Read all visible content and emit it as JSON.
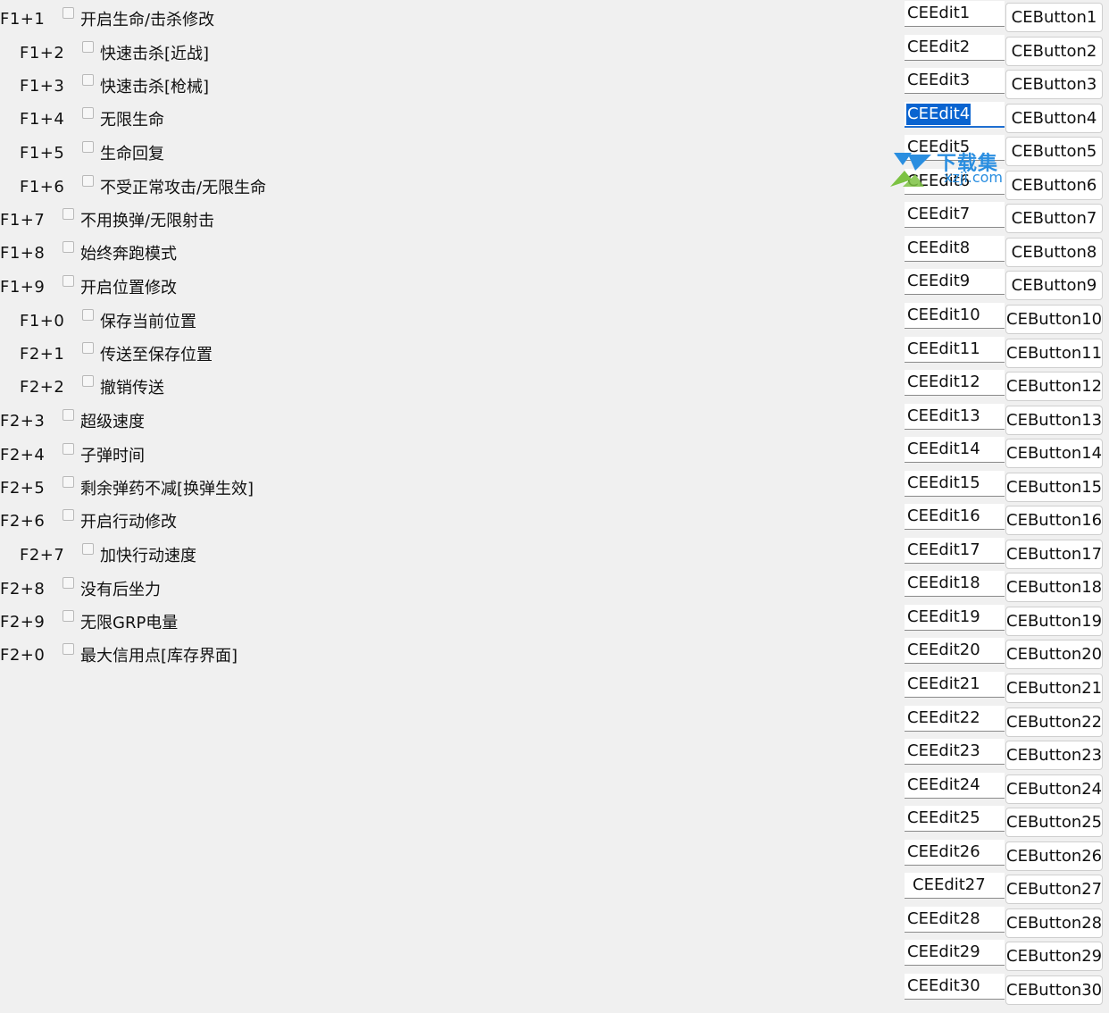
{
  "options": [
    {
      "hotkey": "F1+1",
      "label": "开启生命/击杀修改",
      "indent": false
    },
    {
      "hotkey": "F1+2",
      "label": "快速击杀[近战]",
      "indent": true
    },
    {
      "hotkey": "F1+3",
      "label": "快速击杀[枪械]",
      "indent": true
    },
    {
      "hotkey": "F1+4",
      "label": "无限生命",
      "indent": true
    },
    {
      "hotkey": "F1+5",
      "label": "生命回复",
      "indent": true
    },
    {
      "hotkey": "F1+6",
      "label": "不受正常攻击/无限生命",
      "indent": true
    },
    {
      "hotkey": "F1+7",
      "label": "不用换弹/无限射击",
      "indent": false
    },
    {
      "hotkey": "F1+8",
      "label": "始终奔跑模式",
      "indent": false
    },
    {
      "hotkey": "F1+9",
      "label": "开启位置修改",
      "indent": false
    },
    {
      "hotkey": "F1+0",
      "label": "保存当前位置",
      "indent": true
    },
    {
      "hotkey": "F2+1",
      "label": "传送至保存位置",
      "indent": true
    },
    {
      "hotkey": "F2+2",
      "label": "撤销传送",
      "indent": true
    },
    {
      "hotkey": "F2+3",
      "label": "超级速度",
      "indent": false
    },
    {
      "hotkey": "F2+4",
      "label": "子弹时间",
      "indent": false
    },
    {
      "hotkey": "F2+5",
      "label": "剩余弹药不减[换弹生效]",
      "indent": false
    },
    {
      "hotkey": "F2+6",
      "label": "开启行动修改",
      "indent": false
    },
    {
      "hotkey": "F2+7",
      "label": "加快行动速度",
      "indent": true
    },
    {
      "hotkey": "F2+8",
      "label": "没有后坐力",
      "indent": false
    },
    {
      "hotkey": "F2+9",
      "label": "无限GRP电量",
      "indent": false
    },
    {
      "hotkey": "F2+0",
      "label": "最大信用点[库存界面]",
      "indent": false
    }
  ],
  "controls": [
    {
      "edit": "CEEdit1",
      "button": "CEButton1"
    },
    {
      "edit": "CEEdit2",
      "button": "CEButton2"
    },
    {
      "edit": "CEEdit3",
      "button": "CEButton3"
    },
    {
      "edit": "CEEdit4",
      "button": "CEButton4",
      "selected": true
    },
    {
      "edit": "CEEdit5",
      "button": "CEButton5"
    },
    {
      "edit": "CEEdit6",
      "button": "CEButton6"
    },
    {
      "edit": "CEEdit7",
      "button": "CEButton7"
    },
    {
      "edit": "CEEdit8",
      "button": "CEButton8"
    },
    {
      "edit": "CEEdit9",
      "button": "CEButton9"
    },
    {
      "edit": "CEEdit10",
      "button": "CEButton10"
    },
    {
      "edit": "CEEdit11",
      "button": "CEButton11"
    },
    {
      "edit": "CEEdit12",
      "button": "CEButton12"
    },
    {
      "edit": "CEEdit13",
      "button": "CEButton13"
    },
    {
      "edit": "CEEdit14",
      "button": "CEButton14"
    },
    {
      "edit": "CEEdit15",
      "button": "CEButton15"
    },
    {
      "edit": "CEEdit16",
      "button": "CEButton16"
    },
    {
      "edit": "CEEdit17",
      "button": "CEButton17"
    },
    {
      "edit": "CEEdit18",
      "button": "CEButton18"
    },
    {
      "edit": "CEEdit19",
      "button": "CEButton19"
    },
    {
      "edit": "CEEdit20",
      "button": "CEButton20"
    },
    {
      "edit": "CEEdit21",
      "button": "CEButton21"
    },
    {
      "edit": "CEEdit22",
      "button": "CEButton22"
    },
    {
      "edit": "CEEdit23",
      "button": "CEButton23"
    },
    {
      "edit": "CEEdit24",
      "button": "CEButton24"
    },
    {
      "edit": "CEEdit25",
      "button": "CEButton25"
    },
    {
      "edit": "CEEdit26",
      "button": "CEButton26"
    },
    {
      "edit": "CEEdit27",
      "button": "CEButton27",
      "shifted": true
    },
    {
      "edit": "CEEdit28",
      "button": "CEButton28"
    },
    {
      "edit": "CEEdit29",
      "button": "CEButton29"
    },
    {
      "edit": "CEEdit30",
      "button": "CEButton30"
    }
  ],
  "watermark": {
    "text": "下载集",
    "subtext": "xzji.com",
    "color": "#2a8ee0",
    "icon": "watermark-logo-icon"
  }
}
